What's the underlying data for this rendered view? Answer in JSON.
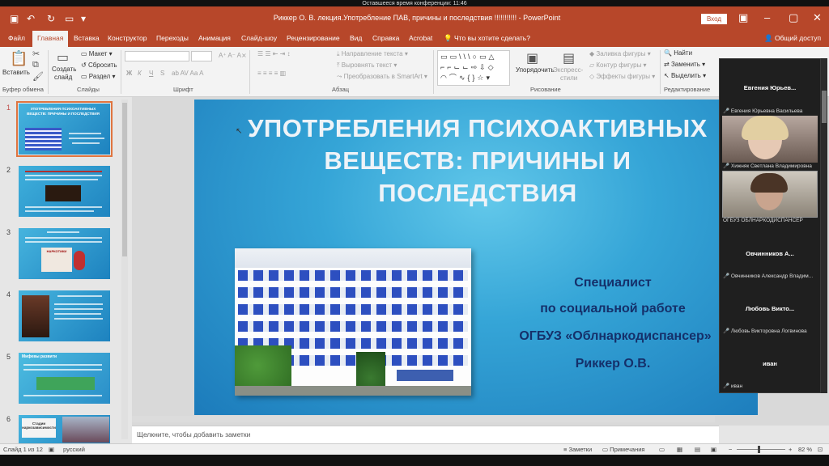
{
  "conference_banner": "Оставшееся время конференции: 11:46",
  "window": {
    "title": "Риккер О. В. лекция.Употребление ПАВ, причины и последствия  !!!!!!!!!!!  -  PowerPoint",
    "login_label": "Вход"
  },
  "tabs": [
    "Файл",
    "Главная",
    "Вставка",
    "Конструктор",
    "Переходы",
    "Анимация",
    "Слайд-шоу",
    "Рецензирование",
    "Вид",
    "Справка",
    "Acrobat"
  ],
  "tell_me": "Что вы хотите сделать?",
  "share": "Общий доступ",
  "ribbon": {
    "paste": "Вставить",
    "create_slide_1": "Создать",
    "create_slide_2": "слайд",
    "layout": "Макет",
    "reset": "Сбросить",
    "section": "Раздел",
    "bold": "Ж",
    "italic": "К",
    "underline": "Ч",
    "strike": "S",
    "text_direction": "Направление текста",
    "align_text": "Выровнять текст",
    "smartart": "Преобразовать в SmartArt",
    "arrange": "Упорядочить",
    "quick_styles_1": "Экспресс-",
    "quick_styles_2": "стили",
    "shape_fill": "Заливка фигуры",
    "shape_outline": "Контур фигуры",
    "shape_effects": "Эффекты фигуры",
    "find": "Найти",
    "replace": "Заменить",
    "select": "Выделить",
    "groups": {
      "clipboard": "Буфер обмена",
      "slides": "Слайды",
      "font": "Шрифт",
      "paragraph": "Абзац",
      "drawing": "Рисование",
      "editing": "Редактирование"
    }
  },
  "thumbnails": {
    "numbers": [
      "1",
      "2",
      "3",
      "4",
      "5",
      "6"
    ],
    "t1": "УПОТРЕБЛЕНИЯ ПСИХОАКТИВНЫХ ВЕЩЕСТВ: ПРИЧИНЫ И ПОСЛЕДСТВИЯ",
    "t3_img": "НАРКОТИКИ",
    "t5": "Мифевы развити",
    "t6": "Стадии наркозависимости"
  },
  "slide": {
    "title": "УПОТРЕБЛЕНИЯ ПСИХОАКТИВНЫХ ВЕЩЕСТВ: ПРИЧИНЫ И ПОСЛЕДСТВИЯ",
    "lines": [
      "Специалист",
      "по социальной работе",
      "ОГБУЗ «Облнаркодиспансер»",
      "Риккер О.В."
    ]
  },
  "notes_placeholder": "Щелкните, чтобы добавить заметки",
  "status": {
    "slide_counter": "Слайд 1 из 12",
    "language": "русский",
    "notes": "Заметки",
    "comments": "Примечания",
    "zoom": "82 %"
  },
  "participants": [
    {
      "display": "Евгения  Юрьев...",
      "label": "Евгения Юрьевна Васильева"
    },
    {
      "display": "",
      "label": "Хижняк Светлана Владимировна"
    },
    {
      "display": "",
      "label": "ОГБУЗ ОБЛНАРКОДИСПАНСЕР"
    },
    {
      "display": "Овчинников  А...",
      "label": "Овчинников Александр Владим..."
    },
    {
      "display": "Любовь  Викто...",
      "label": "Любовь Викторовна Логвинова"
    },
    {
      "display": "иван",
      "label": "иван"
    }
  ],
  "colors": {
    "accent": "#b7472a",
    "slide_title": "#eef3f8",
    "slide_subtitle": "#15306a"
  }
}
